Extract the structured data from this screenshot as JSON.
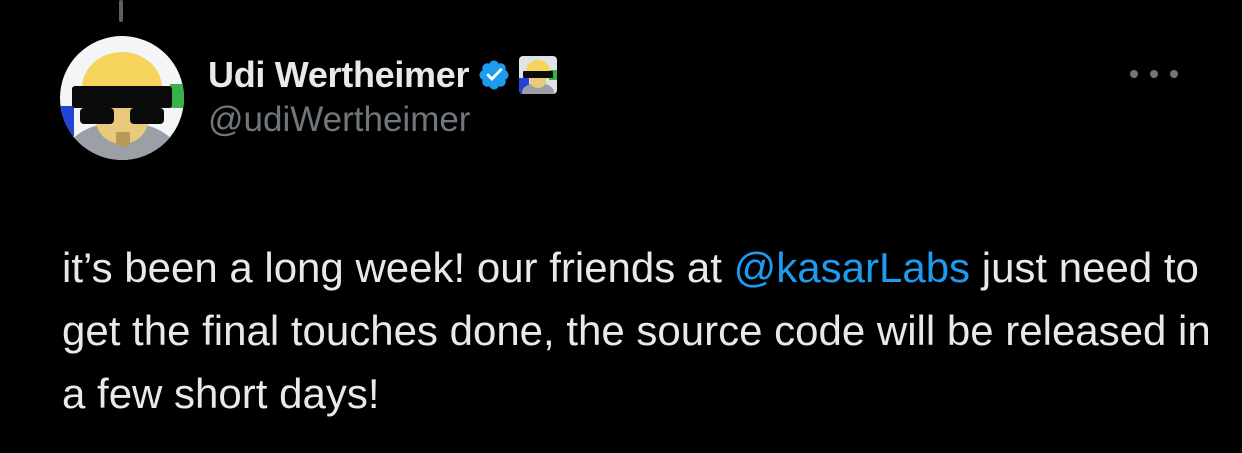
{
  "tweet": {
    "author": {
      "display_name": "Udi Wertheimer",
      "handle": "@udiWertheimer",
      "verified": true,
      "verified_icon": "verified-badge-icon",
      "affiliate_badge": "affiliate-avatar-icon"
    },
    "more_icon": "more-options-icon",
    "text": {
      "part1": "it’s been a long week! our friends at ",
      "mention": "@kasarLabs",
      "part2": " just need to get the final touches done, the source code will be released in a few short days!"
    }
  },
  "colors": {
    "background": "#000000",
    "primary_text": "#e7e9ea",
    "secondary_text": "#71767b",
    "link": "#1d9bf0",
    "verified": "#1d9bf0"
  }
}
